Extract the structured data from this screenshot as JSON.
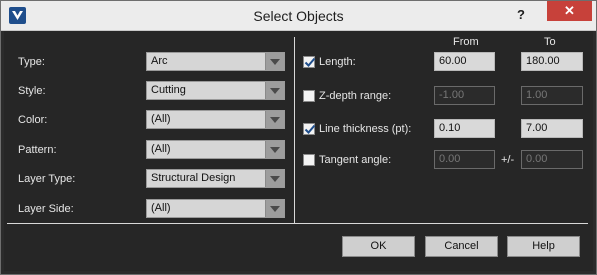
{
  "window": {
    "title": "Select Objects",
    "help_symbol": "?",
    "close_symbol": "✕"
  },
  "left": {
    "rows": [
      {
        "label": "Type:",
        "value": "Arc"
      },
      {
        "label": "Style:",
        "value": "Cutting"
      },
      {
        "label": "Color:",
        "value": "(All)"
      },
      {
        "label": "Pattern:",
        "value": "(All)"
      },
      {
        "label": "Layer Type:",
        "value": "Structural Design"
      },
      {
        "label": "Layer Side:",
        "value": "(All)"
      }
    ]
  },
  "right": {
    "col_from": "From",
    "col_to": "To",
    "rows": [
      {
        "label": "Length:",
        "checked": true,
        "from": "60.00",
        "to": "180.00",
        "enabled": true
      },
      {
        "label": "Z-depth range:",
        "checked": false,
        "from": "-1.00",
        "to": "1.00",
        "enabled": false
      },
      {
        "label": "Line thickness (pt):",
        "checked": true,
        "from": "0.10",
        "to": "7.00",
        "enabled": true
      },
      {
        "label": "Tangent angle:",
        "checked": false,
        "from": "0.00",
        "to": "0.00",
        "enabled": false,
        "separator": "+/-"
      }
    ]
  },
  "buttons": {
    "ok": "OK",
    "cancel": "Cancel",
    "help": "Help"
  },
  "colors": {
    "background": "#2b2b2b",
    "close_button": "#c7413a",
    "app_icon": "#1f4e8c"
  }
}
